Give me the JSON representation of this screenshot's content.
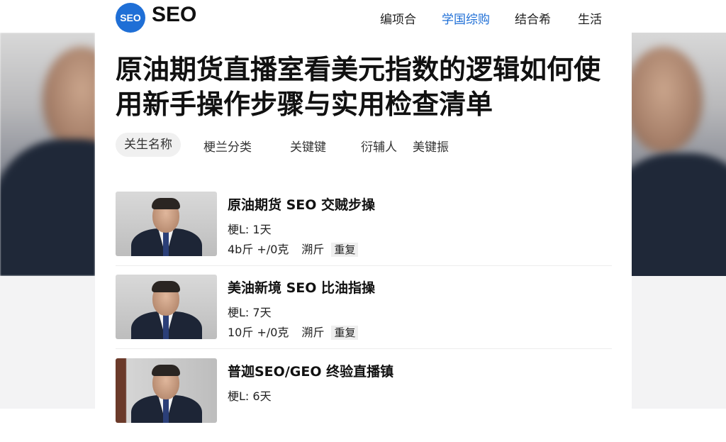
{
  "brand": {
    "logo_text": "SEO",
    "name": "SEO",
    "accent": "#1f6fd6"
  },
  "nav": [
    {
      "label": "编项合"
    },
    {
      "label": "学国综购"
    },
    {
      "label": "结合希"
    },
    {
      "label": "生活"
    }
  ],
  "title": "原油期货直播室看美元指数的逻辑如何使用新手操作步骤与实用检查清单",
  "tags": [
    {
      "label": "关生名称"
    },
    {
      "label": "梗兰分类"
    },
    {
      "label": "关键键"
    },
    {
      "label": "衍辅人"
    },
    {
      "label": "美键振"
    }
  ],
  "articles": [
    {
      "title": "原油期货 SEO 交贼步操",
      "meta": "梗L: 1天",
      "stat": "4b斤 +/0克",
      "label": "溯斤",
      "badge": "重复"
    },
    {
      "title": "美油新境 SEO 比油指操",
      "meta": "梗L: 7天",
      "stat": "10斤 +/0克",
      "label": "溯斤",
      "badge": "重复"
    },
    {
      "title": "普迦SEO/GEO 终验直播镇",
      "meta": "梗L: 6天",
      "stat": "",
      "label": "",
      "badge": ""
    }
  ]
}
